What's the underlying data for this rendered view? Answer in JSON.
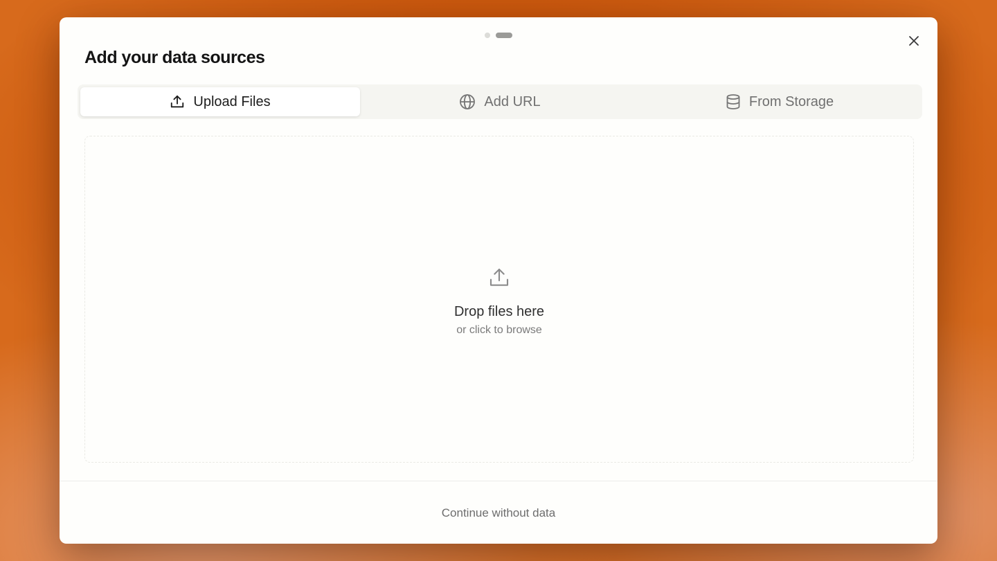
{
  "modal": {
    "title": "Add your data sources",
    "steps": {
      "total": 2,
      "current": 2
    }
  },
  "tabs": [
    {
      "label": "Upload Files",
      "icon": "upload-icon",
      "active": true
    },
    {
      "label": "Add URL",
      "icon": "globe-icon",
      "active": false
    },
    {
      "label": "From Storage",
      "icon": "database-icon",
      "active": false
    }
  ],
  "dropzone": {
    "icon": "upload-icon",
    "title": "Drop files here",
    "subtitle": "or click to browse"
  },
  "footer": {
    "continue_label": "Continue without data"
  },
  "colors": {
    "background": "#cf5c12",
    "modal": "#fefefc",
    "active_tab": "#ffffff",
    "tab_bar": "#f5f5f1"
  }
}
